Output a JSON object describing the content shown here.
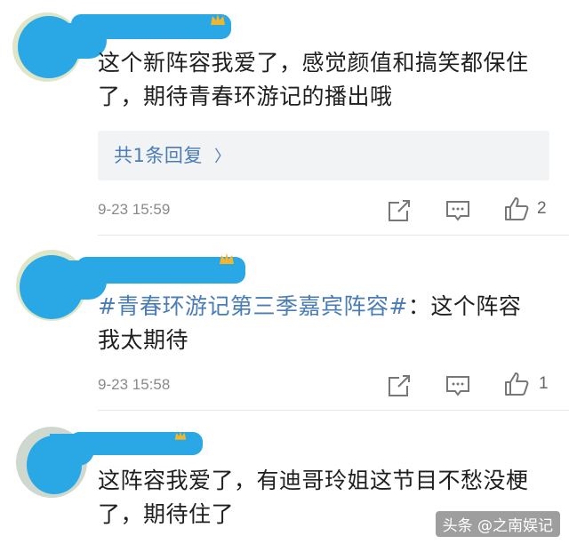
{
  "comments": [
    {
      "text": "这个新阵容我爱了，感觉颜值和搞笑都保住了，期待青春环游记的播出哦",
      "reply_label": "共1条回复",
      "reply_chevron": "〉",
      "timestamp": "9-23 15:59",
      "like_count": "2"
    },
    {
      "hashtag": "#青春环游记第三季嘉宾阵容#",
      "text": "：这个阵容我太期待",
      "timestamp": "9-23 15:58",
      "like_count": "1"
    },
    {
      "text": "这阵容我爱了，有迪哥玲姐这节目不愁没梗了，期待住了"
    }
  ],
  "watermark": "头条 @之南娱记",
  "icons": {
    "share": "share-icon",
    "comment": "comment-icon",
    "like": "thumbs-up-icon"
  },
  "colors": {
    "redaction": "#2aa8e6",
    "link": "#4a7cb5",
    "meta": "#8a8a8a"
  }
}
